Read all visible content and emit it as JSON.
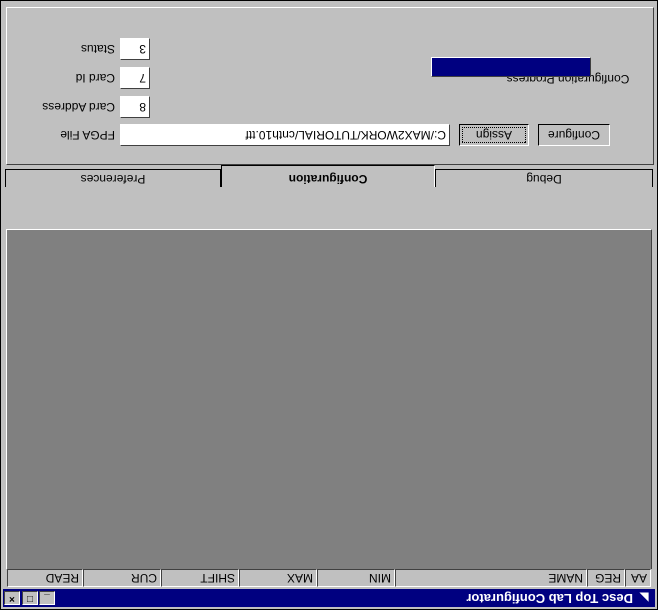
{
  "window": {
    "title": "Desc Top Lab Configurator",
    "icon": "app-icon",
    "controls": {
      "minimize": "_",
      "maximize": "□",
      "close": "×"
    }
  },
  "table": {
    "columns": [
      "AA",
      "REG",
      "NAME",
      "MIN",
      "MAX",
      "SHIFT",
      "CUR",
      "READ"
    ],
    "rows": []
  },
  "tabs": [
    {
      "label": "Preferences",
      "active": false
    },
    {
      "label": "Configuration",
      "active": true
    },
    {
      "label": "Debug",
      "active": false
    }
  ],
  "config": {
    "status_label": "Status",
    "status_value": "3",
    "card_id_label": "Card Id",
    "card_id_value": "7",
    "card_address_label": "Card Address",
    "card_address_value": "8",
    "fpga_file_label": "FPGA File",
    "fpga_file_value": "C:/MAX2WORK/TUTORIAL/cnth10.ttf",
    "assign_label": "Assign",
    "configure_label": "Configure",
    "progress_label": "Configuration Progress",
    "progress_fraction": 1.0
  },
  "colors": {
    "title_bar": "#000080",
    "progress_fill": "#000080",
    "list_bg": "#808080",
    "face": "#c0c0c0"
  }
}
